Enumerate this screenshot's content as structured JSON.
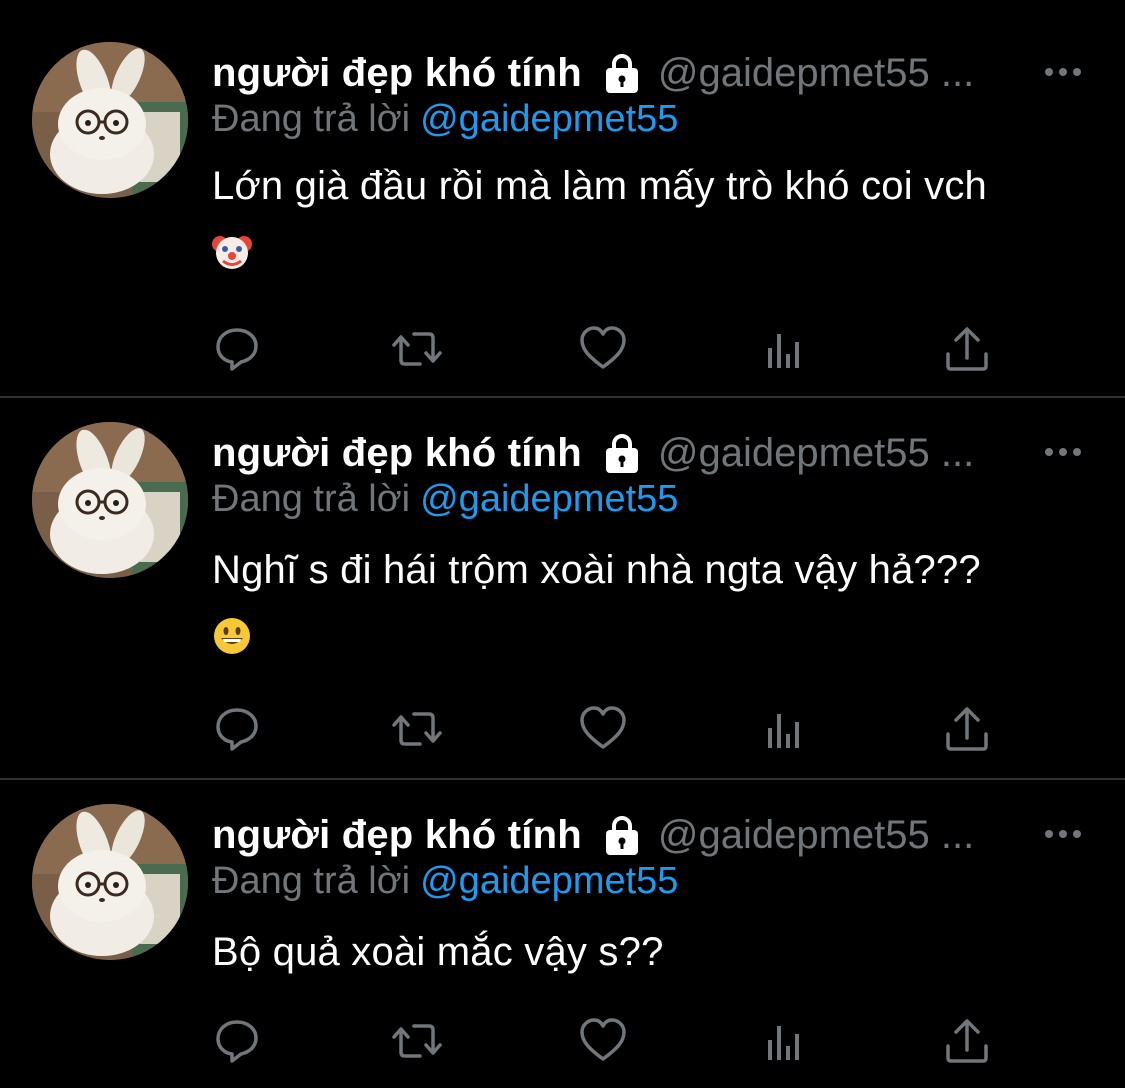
{
  "tweets": [
    {
      "display_name": "người đẹp khó tính",
      "handle": "@gaidepmet55 ...",
      "reply_prefix": "Đang trả lời",
      "reply_mention": "@gaidepmet55",
      "text": "Lớn già đầu rồi mà làm mấy trò khó coi vch",
      "emoji": "clown-face-icon"
    },
    {
      "display_name": "người đẹp khó tính",
      "handle": "@gaidepmet55 ...",
      "reply_prefix": "Đang trả lời",
      "reply_mention": "@gaidepmet55",
      "text": "Nghĩ s đi hái trộm xoài nhà ngta vậy hả???",
      "emoji": "grinning-face-icon"
    },
    {
      "display_name": "người đẹp khó tính",
      "handle": "@gaidepmet55 ...",
      "reply_prefix": "Đang trả lời",
      "reply_mention": "@gaidepmet55",
      "text": "Bộ quả xoài mắc vậy s??"
    }
  ],
  "icons": {
    "avatar": "bunny-with-glasses-avatar",
    "protected": "lock-icon",
    "more": "more-dots-icon",
    "actions": [
      "reply-icon",
      "retweet-icon",
      "like-icon",
      "views-icon",
      "share-icon"
    ]
  },
  "colors": {
    "background": "#000000",
    "divider": "#2f3336",
    "name": "#ffffff",
    "muted": "#71767b",
    "mention": "#1d9bf0"
  }
}
